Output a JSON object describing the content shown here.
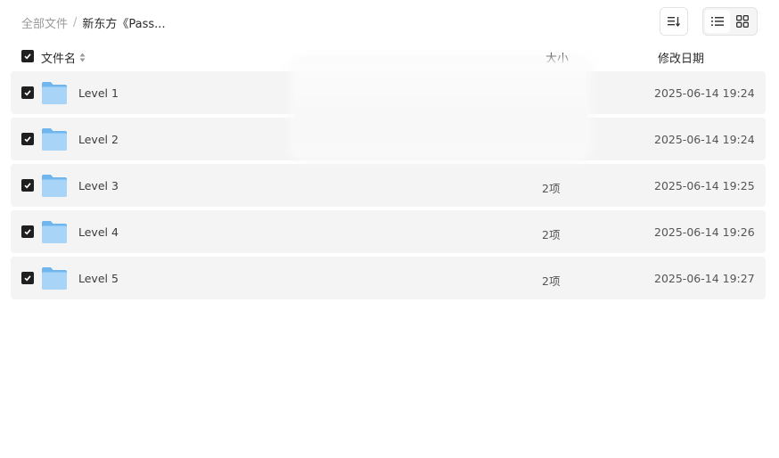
{
  "breadcrumb": {
    "root": "全部文件",
    "separator": "/",
    "current": "新东方《Pass..."
  },
  "toolbar": {
    "sort_icon": "sort-icon",
    "list_view_icon": "list-view-icon",
    "grid_view_icon": "grid-view-icon",
    "active_view": "list"
  },
  "table": {
    "columns": {
      "name": "文件名",
      "size": "大小",
      "date": "修改日期"
    },
    "rows": [
      {
        "name": "Level 1",
        "size": "",
        "date": "2025-06-14 19:24",
        "checked": true
      },
      {
        "name": "Level 2",
        "size": "",
        "date": "2025-06-14 19:24",
        "checked": true
      },
      {
        "name": "Level 3",
        "size": "2项",
        "date": "2025-06-14 19:25",
        "checked": true
      },
      {
        "name": "Level 4",
        "size": "2项",
        "date": "2025-06-14 19:26",
        "checked": true
      },
      {
        "name": "Level 5",
        "size": "2项",
        "date": "2025-06-14 19:27",
        "checked": true
      }
    ]
  },
  "colors": {
    "row_bg": "#f4f4f4",
    "checkbox": "#1f1f1f",
    "folder_light": "#a8d4f8",
    "folder_dark": "#6fb6ef"
  }
}
